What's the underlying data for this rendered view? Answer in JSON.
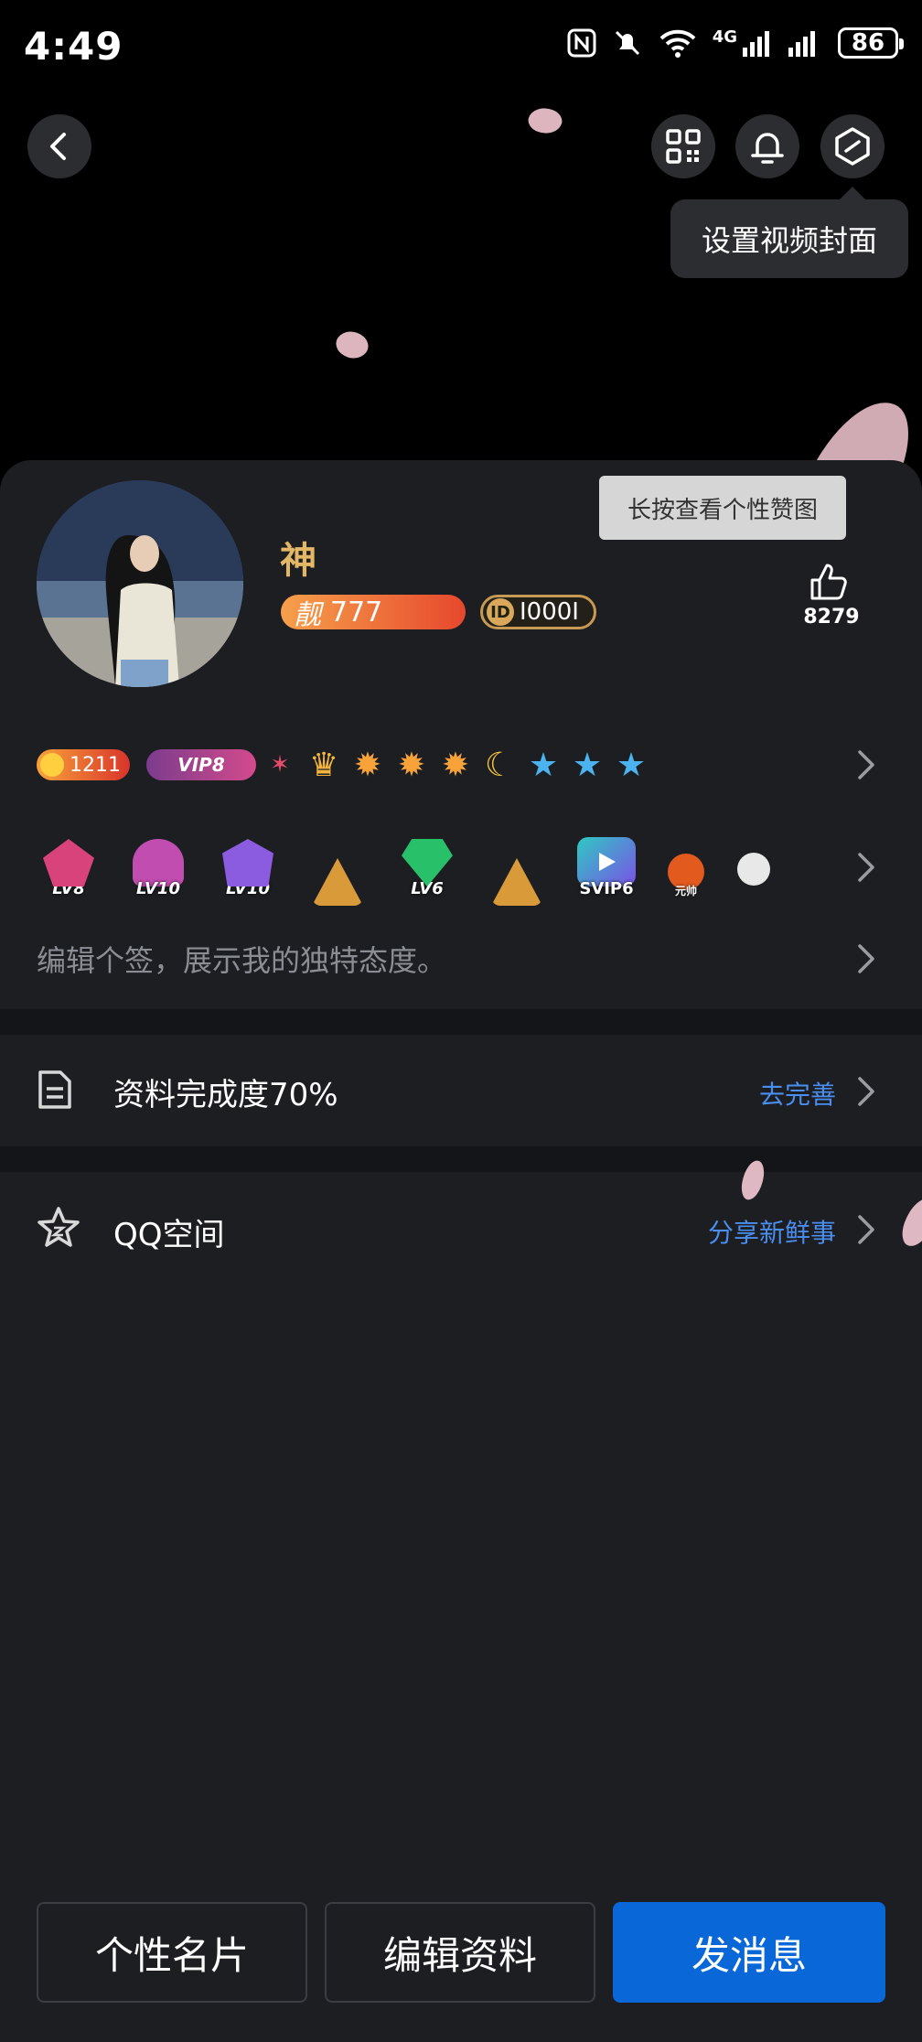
{
  "status_bar": {
    "time": "4:49",
    "network_label": "4G",
    "battery": "86"
  },
  "top_nav": {
    "back_icon": "chevron-left-icon",
    "qr_icon": "qr-code-icon",
    "bell_icon": "bell-icon",
    "settings_icon": "hexagon-settings-icon"
  },
  "tooltip": {
    "text": "设置视频封面"
  },
  "profile": {
    "nickname": "神",
    "liang_badge": {
      "prefix": "靓",
      "number": "777"
    },
    "id_badge": {
      "icon_text": "ID",
      "text": "I000I"
    },
    "longpress_tip": "长按查看个性赞图",
    "like_count": "8279"
  },
  "badges": {
    "coin": "1211",
    "vip": "VIP8",
    "level_row": [
      {
        "label": "LV8",
        "color": "#d8437c"
      },
      {
        "label": "LV10",
        "color": "#c24db0"
      },
      {
        "label": "LV10",
        "color": "#8b5ce0"
      },
      {
        "label": "",
        "color": "#d99a3a"
      },
      {
        "label": "LV6",
        "color": "#29c06a"
      },
      {
        "label": "",
        "color": "#d99a3a"
      }
    ],
    "svip": "SVIP6",
    "game_badge": "元帅"
  },
  "signature": {
    "text": "编辑个签，展示我的独特态度。"
  },
  "profile_completion": {
    "label": "资料完成度70%",
    "action": "去完善"
  },
  "qzone": {
    "label": "QQ空间",
    "action": "分享新鲜事"
  },
  "buttons": {
    "card": "个性名片",
    "edit": "编辑资料",
    "message": "发消息"
  },
  "colors": {
    "accent_blue": "#0a67d8",
    "link_blue": "#4a8ef0",
    "gold": "#e3b766",
    "card_bg": "#1c1e22"
  }
}
